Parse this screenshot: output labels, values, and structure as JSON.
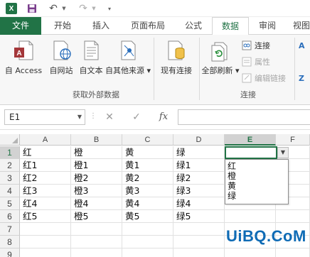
{
  "quick_access": {
    "app_logo": "X",
    "icons": [
      "excel-logo",
      "save-icon",
      "undo-icon",
      "redo-icon",
      "customize-qat-icon"
    ]
  },
  "tabs": [
    {
      "label": "文件",
      "active": false
    },
    {
      "label": "开始",
      "active": false
    },
    {
      "label": "插入",
      "active": false
    },
    {
      "label": "页面布局",
      "active": false
    },
    {
      "label": "公式",
      "active": false
    },
    {
      "label": "数据",
      "active": true
    },
    {
      "label": "审阅",
      "active": false
    },
    {
      "label": "视图",
      "active": false
    }
  ],
  "ribbon": {
    "get_external": {
      "buttons": [
        "自 Access",
        "自网站",
        "自文本",
        "自其他来源"
      ],
      "label": "获取外部数据"
    },
    "existing_connections": "现有连接",
    "connections": {
      "refresh_all": "全部刷新",
      "connections_btn": "连接",
      "properties_btn": "属性",
      "edit_links_btn": "编辑链接",
      "label": "连接"
    },
    "sort_partial": "A",
    "sort_partial_2": "Z"
  },
  "formula_bar": {
    "name_box": "E1",
    "cancel": "✕",
    "enter": "✓",
    "insert_function": "fx",
    "value": ""
  },
  "grid": {
    "columns": [
      "A",
      "B",
      "C",
      "D",
      "E",
      "F"
    ],
    "selected_column": "E",
    "rows": [
      "1",
      "2",
      "3",
      "4",
      "5",
      "6",
      "7",
      "8",
      "9"
    ],
    "selected_row": "1",
    "cells": [
      [
        "红",
        "橙",
        "黄",
        "绿"
      ],
      [
        "红1",
        "橙1",
        "黄1",
        "绿1"
      ],
      [
        "红2",
        "橙2",
        "黄2",
        "绿2"
      ],
      [
        "红3",
        "橙3",
        "黄3",
        "绿3"
      ],
      [
        "红4",
        "橙4",
        "黄4",
        "绿4"
      ],
      [
        "红5",
        "橙5",
        "黄5",
        "绿5"
      ]
    ],
    "active_cell": "E1",
    "dropdown_options": [
      "红",
      "橙",
      "黄",
      "绿"
    ]
  },
  "watermark": "UiBQ.CoM",
  "colors": {
    "accent": "#217346",
    "header_bg": "#f2f2f2",
    "watermark": "#0f6bb5"
  }
}
